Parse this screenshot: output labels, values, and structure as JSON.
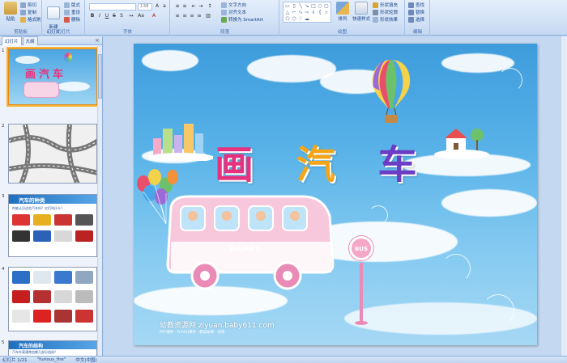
{
  "ribbon": {
    "clipboard": {
      "paste": "粘贴",
      "cut": "剪切",
      "copy": "复制",
      "format_painter": "格式刷",
      "label": "剪贴板"
    },
    "slides": {
      "new_slide": "新建\n幻灯片",
      "layout": "版式",
      "reset": "重设",
      "delete": "删除",
      "label": "幻灯片"
    },
    "font": {
      "font_name": "",
      "font_size": "138",
      "label": "字体"
    },
    "paragraph": {
      "text_direction": "文字方向",
      "align_text": "对齐文本",
      "smartart": "转换为 SmartArt",
      "label": "段落"
    },
    "drawing": {
      "arrange": "排列",
      "quick_styles": "快速样式",
      "shape_fill": "形状填充",
      "shape_outline": "形状轮廓",
      "shape_effects": "形状效果",
      "label": "绘图"
    },
    "editing": {
      "find": "查找",
      "replace": "替换",
      "select": "选择",
      "label": "编辑"
    }
  },
  "left_pane": {
    "tabs": [
      "幻灯片",
      "大纲"
    ],
    "close": "×",
    "thumbnails": [
      {
        "num": "1",
        "title": "画汽车"
      },
      {
        "num": "2",
        "title": ""
      },
      {
        "num": "3",
        "title": "汽车的种类",
        "subtitle": "你能认识这些汽车吗？它们叫什么？"
      },
      {
        "num": "4",
        "title": ""
      },
      {
        "num": "5",
        "title": "汽车的结构",
        "subtitle": "汽车外观通常由哪几部分组成？"
      }
    ]
  },
  "slide": {
    "title_chars": [
      "画",
      "汽",
      "车"
    ],
    "bus_text": "HAPPY",
    "bus_sign": "BUS",
    "watermark": "幼教资源网 ziyuan.baby611.com",
    "watermark_sub": "PPT课件 · FLASH课件 · 教案故事 · 试卷"
  },
  "status": {
    "slide_info": "幻灯片 1/21",
    "theme": "\"furious_fire\"",
    "language": "中文(中国)"
  },
  "colors": {
    "accent_selected": "#f4b33d",
    "title_1": "#e8317e",
    "title_2": "#f4a516",
    "title_3": "#6c3cc4"
  }
}
